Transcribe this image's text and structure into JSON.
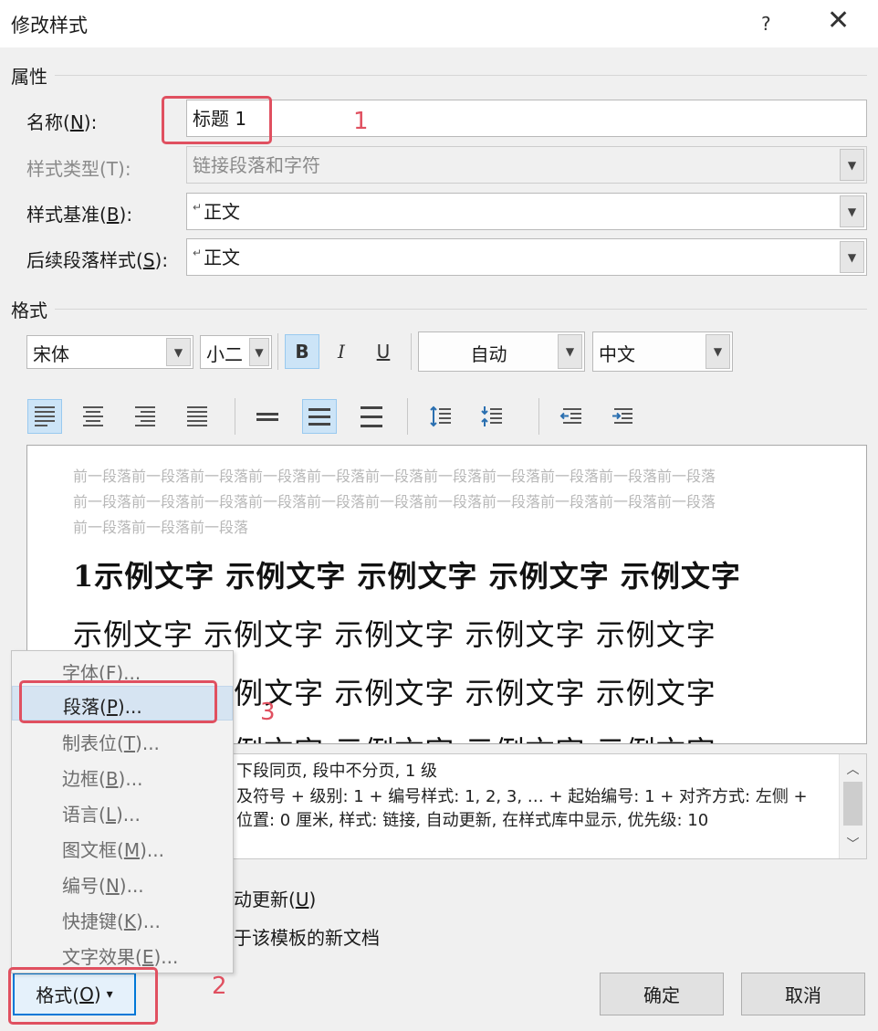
{
  "dialog": {
    "title": "修改样式",
    "help": "?",
    "close": "✕"
  },
  "properties": {
    "section_title": "属性",
    "name_label": "名称(",
    "name_key": "N",
    "name_label_end": "):",
    "name_value": "标题 1",
    "type_label": "样式类型(T):",
    "type_value": "链接段落和字符",
    "based_label": "样式基准(",
    "based_key": "B",
    "based_label_end": "):",
    "based_value": "正文",
    "next_label": "后续段落样式(",
    "next_key": "S",
    "next_label_end": "):",
    "next_value": "正文",
    "para_mark": "↵"
  },
  "format": {
    "section_title": "格式",
    "font": "宋体",
    "size": "小二",
    "bold": "B",
    "italic": "I",
    "underline": "U",
    "color": "自动",
    "script": "中文"
  },
  "preview": {
    "prev_lines": [
      "前一段落前一段落前一段落前一段落前一段落前一段落前一段落前一段落前一段落前一段落前一段落",
      "前一段落前一段落前一段落前一段落前一段落前一段落前一段落前一段落前一段落前一段落前一段落",
      "前一段落前一段落前一段落"
    ],
    "sample_lines": [
      "1示例文字 示例文字 示例文字 示例文字 示例文字",
      "示例文字 示例文字 示例文字 示例文字 示例文字",
      "示例文字 示例文字 示例文字 示例文字 示例文字",
      "示例文字 示例文字 示例文字 示例文字 示例文字"
    ]
  },
  "description": {
    "lines": [
      "下段同页, 段中不分页, 1 级",
      "及符号 + 级别: 1 + 编号样式: 1, 2, 3, … + 起始编号: 1 + 对齐方式: 左侧 +",
      "位置:  0 厘米, 样式: 链接, 自动更新, 在样式库中显示, 优先级: 10"
    ]
  },
  "options": {
    "auto_update": "动更新(",
    "auto_update_key": "U",
    "auto_update_end": ")",
    "template_docs": "于该模板的新文档"
  },
  "menu": {
    "items": [
      {
        "label": "字体(",
        "key": "F",
        "end": ")..."
      },
      {
        "label": "段落(",
        "key": "P",
        "end": ")..."
      },
      {
        "label": "制表位(",
        "key": "T",
        "end": ")..."
      },
      {
        "label": "边框(",
        "key": "B",
        "end": ")..."
      },
      {
        "label": "语言(",
        "key": "L",
        "end": ")..."
      },
      {
        "label": "图文框(",
        "key": "M",
        "end": ")..."
      },
      {
        "label": "编号(",
        "key": "N",
        "end": ")..."
      },
      {
        "label": "快捷键(",
        "key": "K",
        "end": ")..."
      },
      {
        "label": "文字效果(",
        "key": "E",
        "end": ")..."
      }
    ]
  },
  "buttons": {
    "format_label": "格式(",
    "format_key": "O",
    "format_end": ")",
    "format_arrow": "▾",
    "ok": "确定",
    "cancel": "取消"
  },
  "annotations": {
    "step1": "1",
    "step2": "2",
    "step3": "3",
    "color": "#e05060"
  }
}
